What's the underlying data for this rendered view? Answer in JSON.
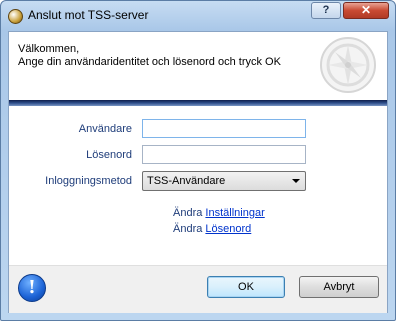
{
  "window": {
    "title": "Anslut mot TSS-server"
  },
  "titlebar": {
    "help_label": "?",
    "close_label": "✕"
  },
  "header": {
    "line1": "Välkommen,",
    "line2": "Ange din användaridentitet och lösenord och tryck OK"
  },
  "form": {
    "username_label": "Användare",
    "username_value": "",
    "password_label": "Lösenord",
    "password_value": "",
    "method_label": "Inloggningsmetod",
    "method_value": "TSS-Användare"
  },
  "links": {
    "settings_prefix": "Ändra",
    "settings_link": "Inställningar",
    "password_prefix": "Ändra",
    "password_link": "Lösenord"
  },
  "footer": {
    "info_icon": "info-icon",
    "info_glyph": "!",
    "ok_label": "OK",
    "cancel_label": "Avbryt"
  }
}
